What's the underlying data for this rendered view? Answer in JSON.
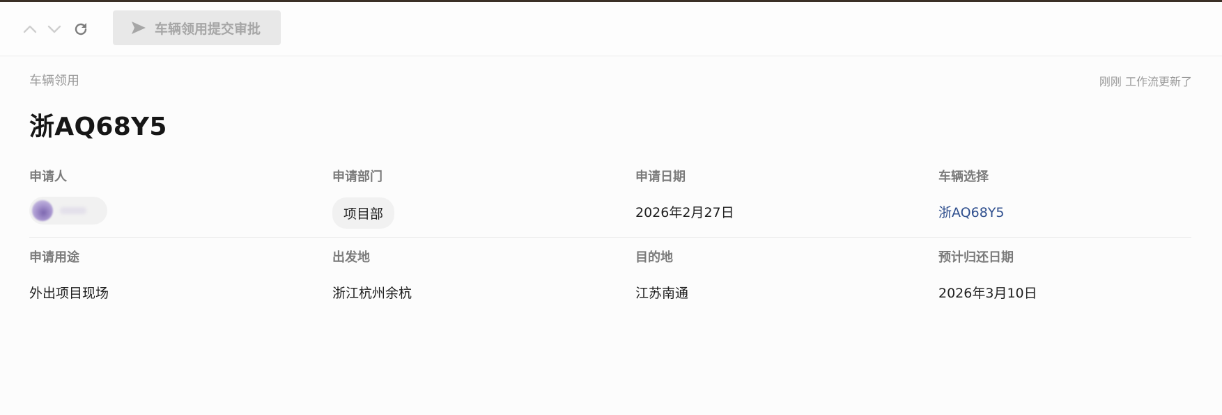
{
  "toolbar": {
    "up_icon": "chevron-up-icon",
    "down_icon": "chevron-down-icon",
    "refresh_icon": "refresh-icon",
    "submit_label": "车辆领用提交审批",
    "submit_icon": "send-icon"
  },
  "header": {
    "breadcrumb": "车辆领用",
    "status": "刚刚 工作流更新了",
    "title": "浙AQ68Y5"
  },
  "fields": {
    "applicant": {
      "label": "申请人",
      "value": ""
    },
    "department": {
      "label": "申请部门",
      "value": "项目部"
    },
    "apply_date": {
      "label": "申请日期",
      "value": "2026年2月27日"
    },
    "vehicle": {
      "label": "车辆选择",
      "value": "浙AQ68Y5"
    },
    "purpose": {
      "label": "申请用途",
      "value": "外出项目现场"
    },
    "origin": {
      "label": "出发地",
      "value": "浙江杭州余杭"
    },
    "destination": {
      "label": "目的地",
      "value": "江苏南通"
    },
    "return_date": {
      "label": "预计归还日期",
      "value": "2026年3月10日"
    }
  },
  "colors": {
    "link": "#2f4f8e",
    "disabled_button_bg": "#e8e8e8",
    "top_rule": "#3a3026"
  }
}
